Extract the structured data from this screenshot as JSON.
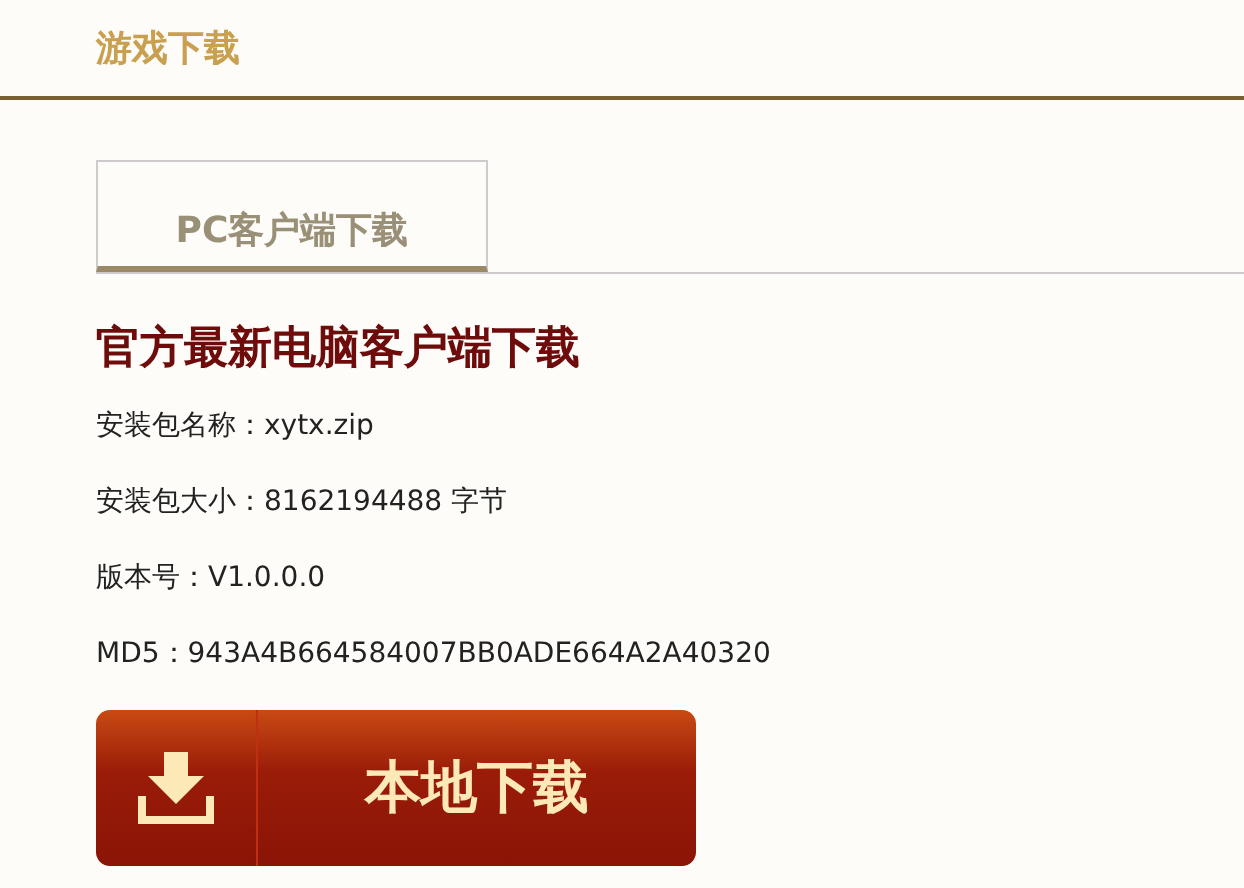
{
  "header": {
    "title": "游戏下载"
  },
  "tabs": [
    {
      "label": "PC客户端下载",
      "selected": true
    }
  ],
  "section": {
    "title": "官方最新电脑客户端下载",
    "details": [
      {
        "label": "安装包名称：",
        "value": "xytx.zip"
      },
      {
        "label": "安装包大小：",
        "value": "8162194488 字节"
      },
      {
        "label": "版本号：",
        "value": "V1.0.0.0"
      },
      {
        "label": "MD5：",
        "value": "943A4B664584007BB0ADE664A2A40320"
      }
    ],
    "download_button": {
      "label": "本地下载"
    }
  }
}
